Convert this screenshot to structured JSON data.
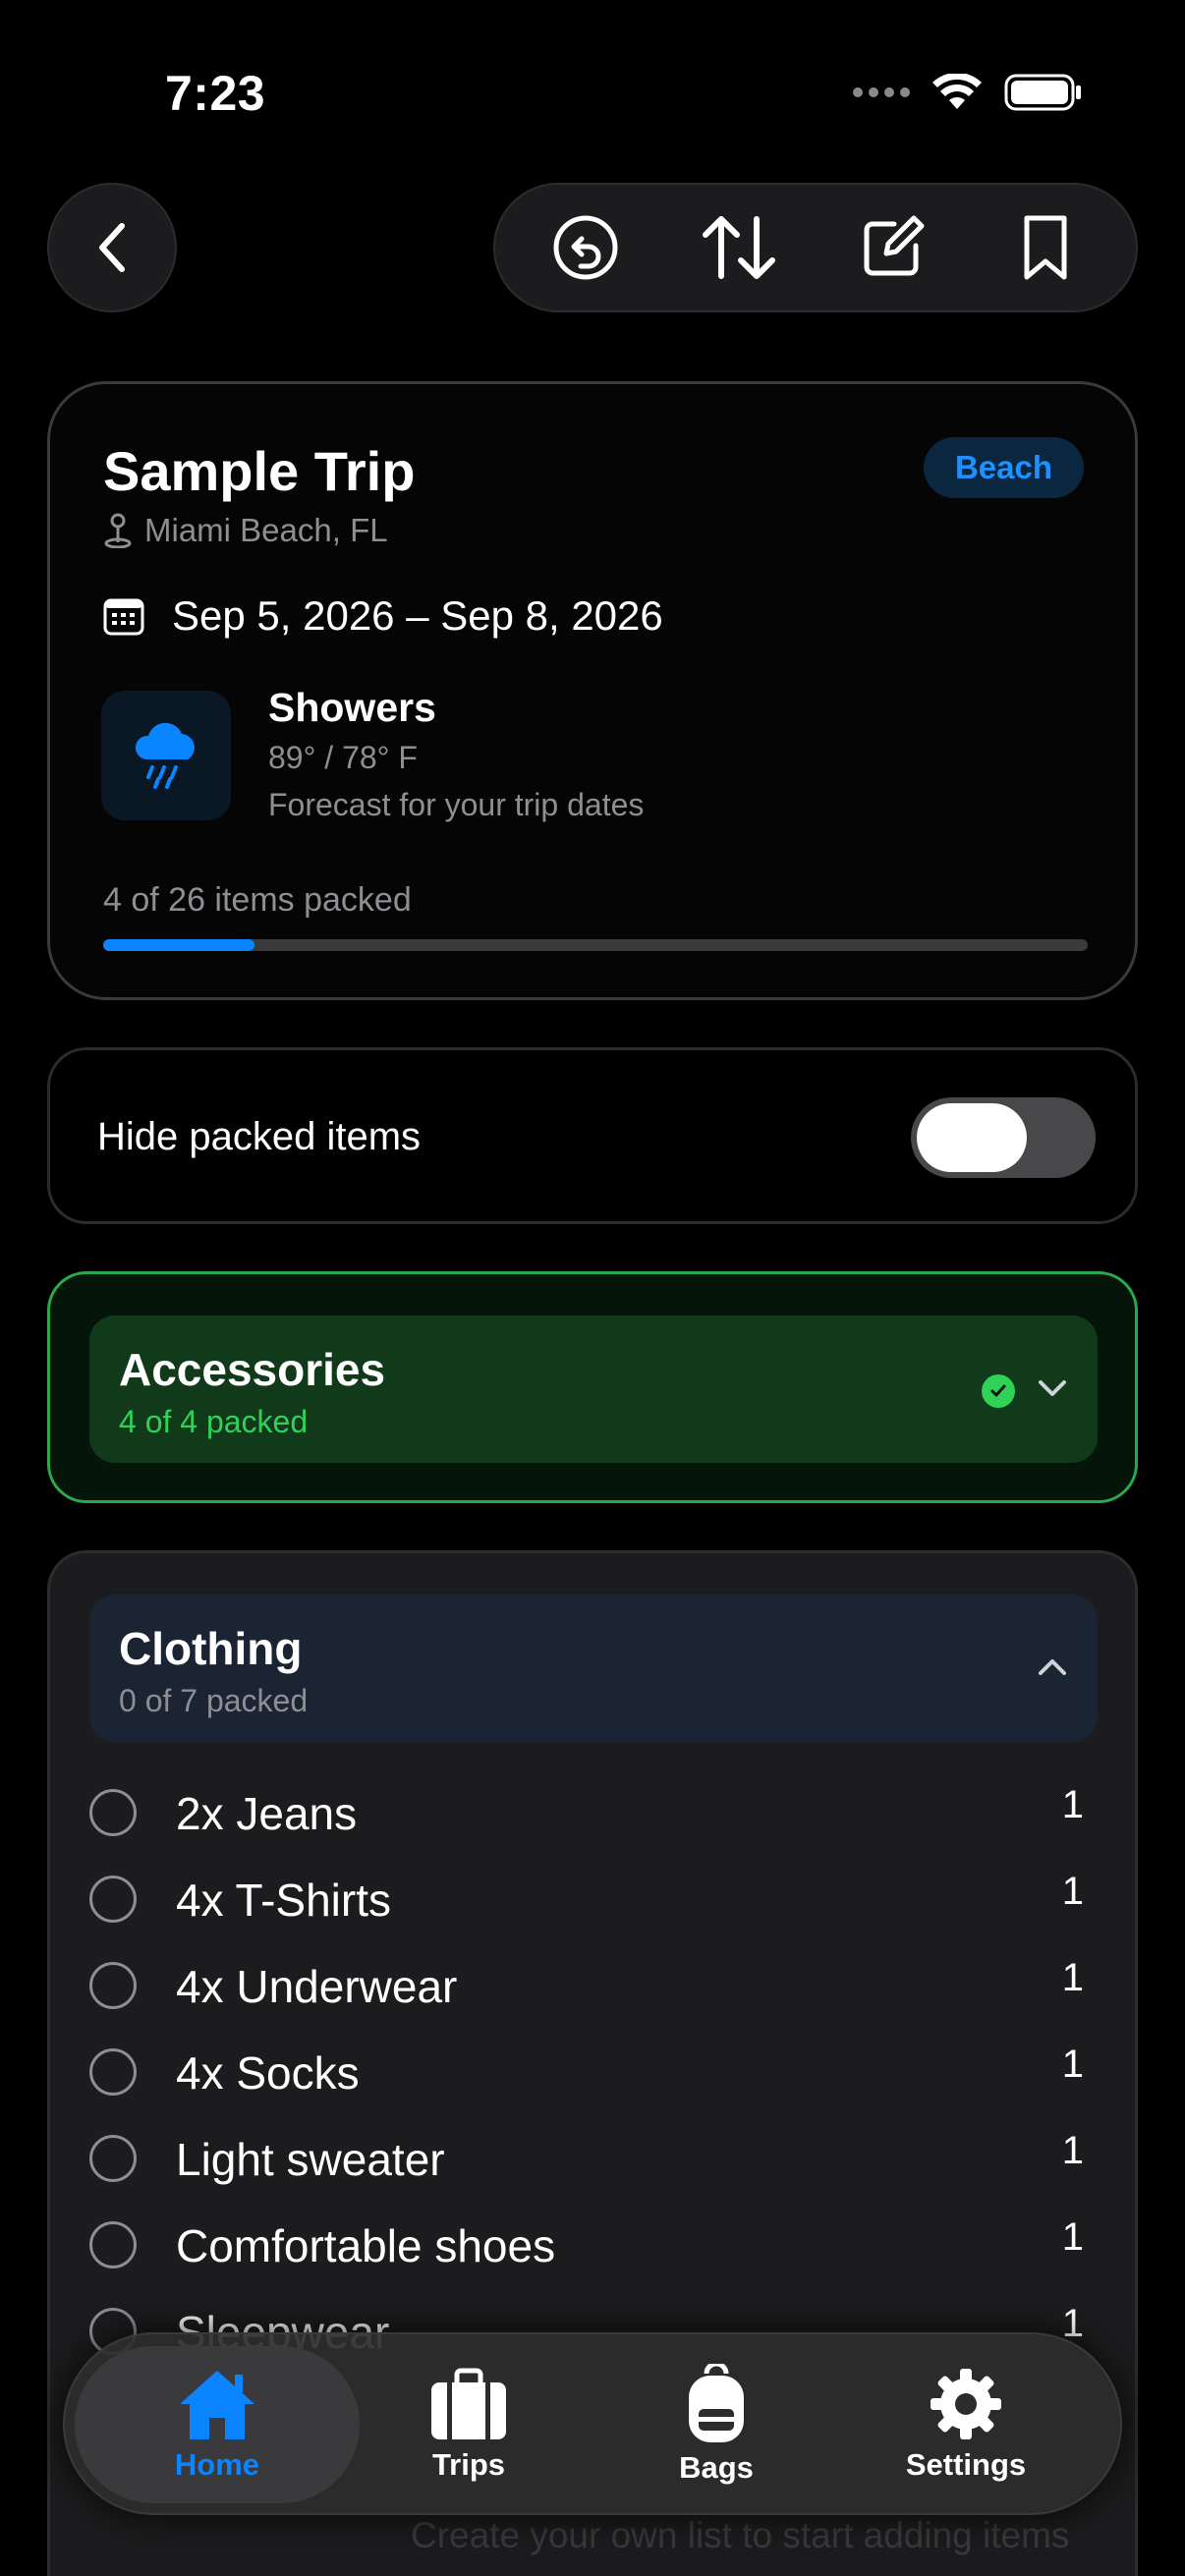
{
  "status": {
    "time": "7:23"
  },
  "trip": {
    "name": "Sample Trip",
    "tag": "Beach",
    "location": "Miami Beach, FL",
    "dates": "Sep 5, 2026 – Sep 8, 2026",
    "weather": {
      "condition": "Showers",
      "temps": "89° / 78° F",
      "note": "Forecast for your trip dates",
      "icon": "cloud-rain-icon"
    },
    "progress_text": "4 of 26 items packed",
    "packed": 4,
    "total": 26
  },
  "hide_packed": {
    "label": "Hide packed items",
    "enabled": false
  },
  "categories": [
    {
      "name": "Accessories",
      "status": "4 of 4 packed",
      "expanded": false,
      "complete": true
    },
    {
      "name": "Clothing",
      "status": "0 of 7 packed",
      "expanded": true,
      "items": [
        {
          "name": "2x Jeans",
          "qty": "1"
        },
        {
          "name": "4x T-Shirts",
          "qty": "1"
        },
        {
          "name": "4x Underwear",
          "qty": "1"
        },
        {
          "name": "4x Socks",
          "qty": "1"
        },
        {
          "name": "Light sweater",
          "qty": "1"
        },
        {
          "name": "Comfortable shoes",
          "qty": "1"
        },
        {
          "name": "Sleepwear",
          "qty": "1"
        }
      ]
    }
  ],
  "footer_hint": "Create your own list to start adding items",
  "tabs": [
    {
      "label": "Home",
      "icon": "house-icon",
      "active": true
    },
    {
      "label": "Trips",
      "icon": "suitcase-icon",
      "active": false
    },
    {
      "label": "Bags",
      "icon": "backpack-icon",
      "active": false
    },
    {
      "label": "Settings",
      "icon": "gear-icon",
      "active": false
    }
  ],
  "colors": {
    "accent": "#0a84ff",
    "success": "#30d158",
    "background": "#000000"
  }
}
